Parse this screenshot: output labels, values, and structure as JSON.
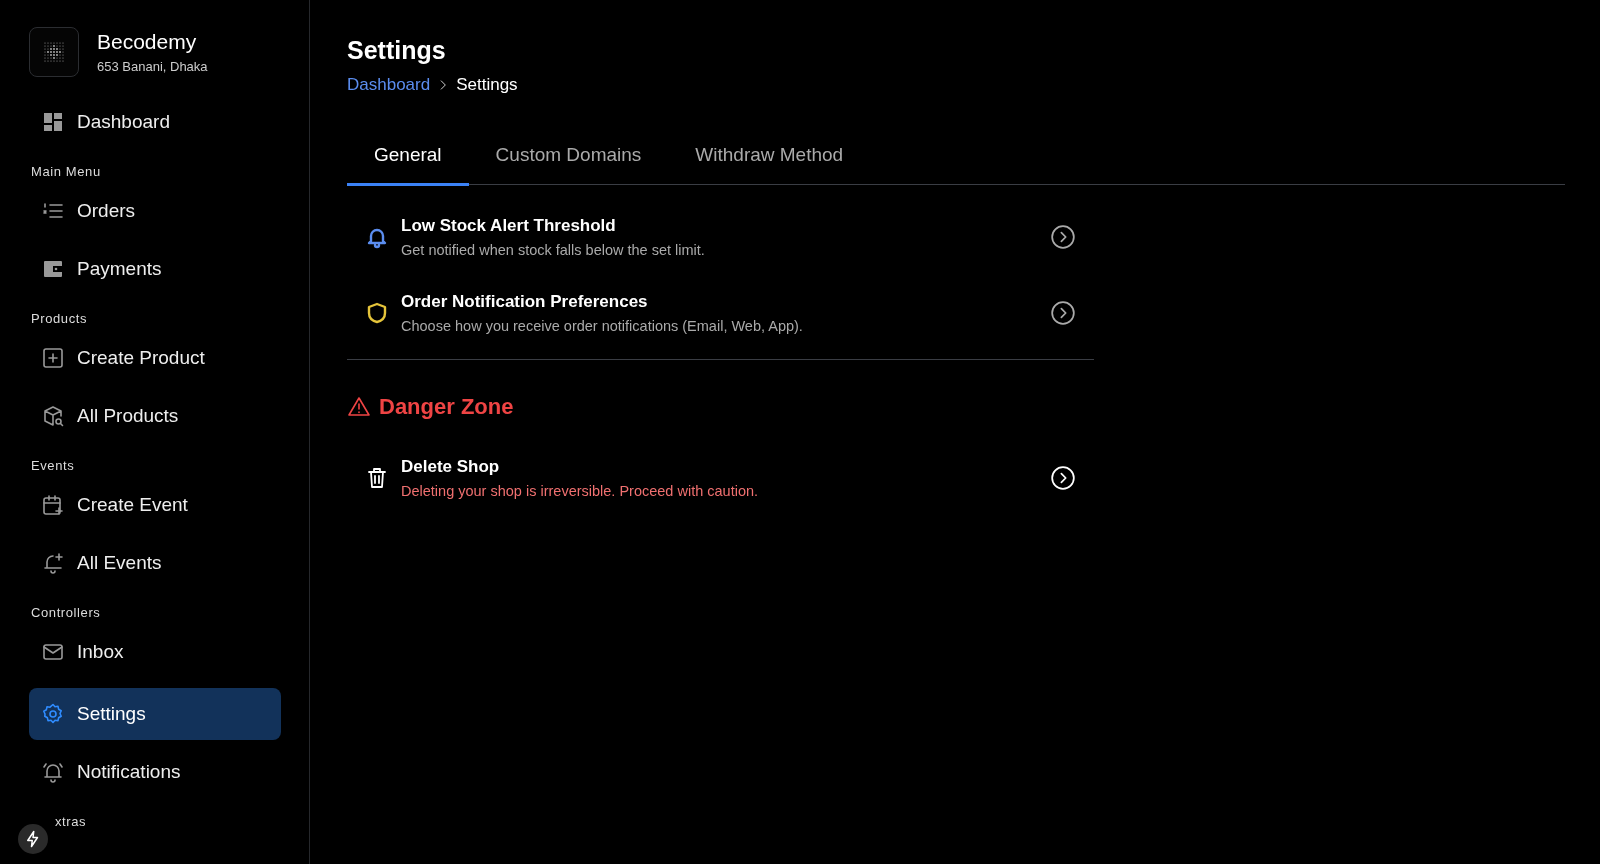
{
  "brand": {
    "name": "Becodemy",
    "address": "653 Banani, Dhaka"
  },
  "sidebar": {
    "items": [
      {
        "kind": "item",
        "label": "Dashboard",
        "selected": false
      },
      {
        "kind": "section",
        "label": "Main Menu"
      },
      {
        "kind": "item",
        "label": "Orders",
        "selected": false
      },
      {
        "kind": "item",
        "label": "Payments",
        "selected": false
      },
      {
        "kind": "section",
        "label": "Products"
      },
      {
        "kind": "item",
        "label": "Create Product",
        "selected": false
      },
      {
        "kind": "item",
        "label": "All Products",
        "selected": false
      },
      {
        "kind": "section",
        "label": "Events"
      },
      {
        "kind": "item",
        "label": "Create Event",
        "selected": false
      },
      {
        "kind": "item",
        "label": "All Events",
        "selected": false
      },
      {
        "kind": "section",
        "label": "Controllers"
      },
      {
        "kind": "item",
        "label": "Inbox",
        "selected": false
      },
      {
        "kind": "item",
        "label": "Settings",
        "selected": true
      },
      {
        "kind": "item",
        "label": "Notifications",
        "selected": false
      },
      {
        "kind": "section",
        "label": "xtras"
      }
    ]
  },
  "page": {
    "title": "Settings",
    "breadcrumb": [
      {
        "label": "Dashboard",
        "kind": "link"
      },
      {
        "label": "Settings",
        "kind": "current"
      }
    ]
  },
  "tabs": [
    {
      "label": "General",
      "selected": true
    },
    {
      "label": "Custom Domains",
      "selected": false
    },
    {
      "label": "Withdraw Method",
      "selected": false
    }
  ],
  "settings": [
    {
      "title": "Low Stock Alert Threshold",
      "description": "Get notified when stock falls below the set limit.",
      "kind": "bell",
      "color": "#5b8def"
    },
    {
      "title": "Order Notification Preferences",
      "description": "Choose how you receive order notifications (Email, Web, App).",
      "kind": "shield",
      "color": "#e5c43a"
    }
  ],
  "danger_zone": {
    "title": "Danger Zone",
    "items": [
      {
        "title": "Delete Shop",
        "description": "Deleting your shop is irreversible. Proceed with caution.",
        "kind": "trash"
      }
    ]
  }
}
